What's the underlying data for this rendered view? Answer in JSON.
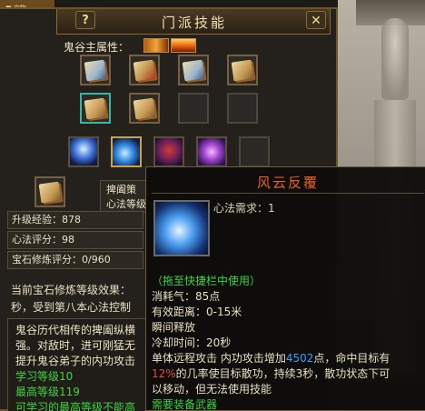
{
  "window": {
    "title": "门派技能",
    "help_label": "?",
    "close_label": "✕",
    "corner_tab_text": "■ 宠物"
  },
  "attribute": {
    "label": "鬼谷主属性：",
    "icons": [
      "gold-element-icon",
      "fire-element-icon"
    ]
  },
  "technique_slots": {
    "rows": [
      [
        "book-icon",
        "book-icon",
        "book-icon",
        "book-icon"
      ],
      [
        "book-icon",
        "book-icon",
        "empty",
        "empty"
      ]
    ]
  },
  "skill_bar": [
    "ice-aura-skill-icon",
    "palm-strike-skill-icon",
    "crimson-demon-skill-icon",
    "violet-burst-skill-icon",
    "empty"
  ],
  "selected_technique": {
    "icon": "book-icon",
    "name_partial": "捭阖策",
    "level_partial": "心法等级"
  },
  "stats": {
    "exp_label": "升级经验：",
    "exp_value": "878",
    "score_label": "心法评分：",
    "score_value": "98",
    "gem_label": "宝石修炼评分：",
    "gem_value": "0/960"
  },
  "gem_desc": {
    "line1": "当前宝石修炼等级效果：",
    "line2": "秒，受到第八本心法控制"
  },
  "description": {
    "line1": "鬼谷历代相传的捭阖纵横",
    "line2": "强。对敌时，进可刚猛无",
    "line3": "提升鬼谷弟子的内功攻击",
    "line4": "学习等级10",
    "line5": "最高等级119",
    "line6": "可学习的最高等级不能高"
  },
  "tooltip": {
    "title": "风云反覆",
    "requirement": "心法需求：1",
    "hint": "（拖至快捷栏中使用）",
    "mana_cost": "消耗气：85点",
    "range": "有效距离：0-15米",
    "cast": "瞬间释放",
    "cooldown": "冷却时间：20秒",
    "effect_prefix": "单体远程攻击  内功攻击增加",
    "effect_value": "4502",
    "effect_suffix": "点，命中目标有",
    "chance_value": "12%",
    "chance_suffix": "的几率使目标散功，持续3秒，散功状态下可",
    "effect_line3": "以移动，但无法使用技能",
    "requirement_weapon": "需要装备武器"
  }
}
